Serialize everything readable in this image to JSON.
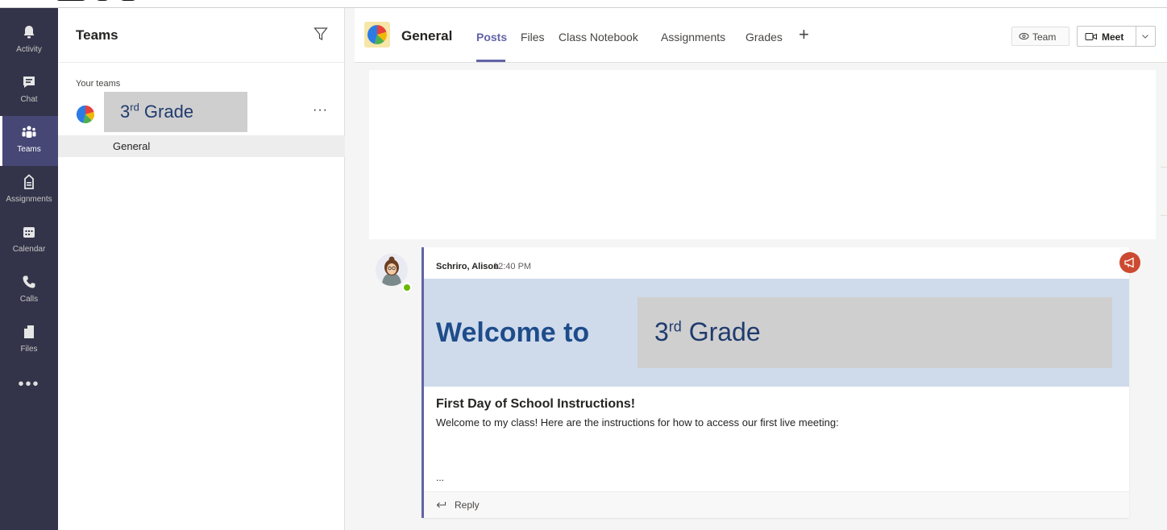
{
  "rail": {
    "items": [
      {
        "label": "Activity",
        "icon": "bell-icon"
      },
      {
        "label": "Chat",
        "icon": "chat-icon"
      },
      {
        "label": "Teams",
        "icon": "teams-icon",
        "active": true
      },
      {
        "label": "Assignments",
        "icon": "assignments-icon"
      },
      {
        "label": "Calendar",
        "icon": "calendar-icon"
      },
      {
        "label": "Calls",
        "icon": "phone-icon"
      },
      {
        "label": "Files",
        "icon": "file-icon"
      }
    ],
    "more": "•••"
  },
  "teams_panel": {
    "title": "Teams",
    "section_label": "Your teams",
    "team": {
      "name_main": "3",
      "name_sup": "rd",
      "name_rest": " Grade"
    },
    "team_more": "···",
    "channel": "General"
  },
  "header": {
    "channel": "General",
    "tabs": [
      "Posts",
      "Files",
      "Class Notebook",
      "Assignments",
      "Grades"
    ],
    "add_tab": "+",
    "team_button": "Team",
    "meet_button": "Meet"
  },
  "post": {
    "author": "Schriro, Alison",
    "time": "12:40 PM",
    "welcome": "Welcome to",
    "grade": {
      "main": "3",
      "sup": "rd",
      "rest": " Grade"
    },
    "subject": "First Day of School Instructions!",
    "body": "Welcome to my class! Here are the instructions for how to access our first live meeting:",
    "ellipsis": "...",
    "reply": "Reply"
  },
  "colors": {
    "rail": "#33344a",
    "accent": "#6264a7",
    "banner": "#cfdbeb",
    "welcome_text": "#1e4c8b",
    "announcement": "#cc4a31"
  }
}
